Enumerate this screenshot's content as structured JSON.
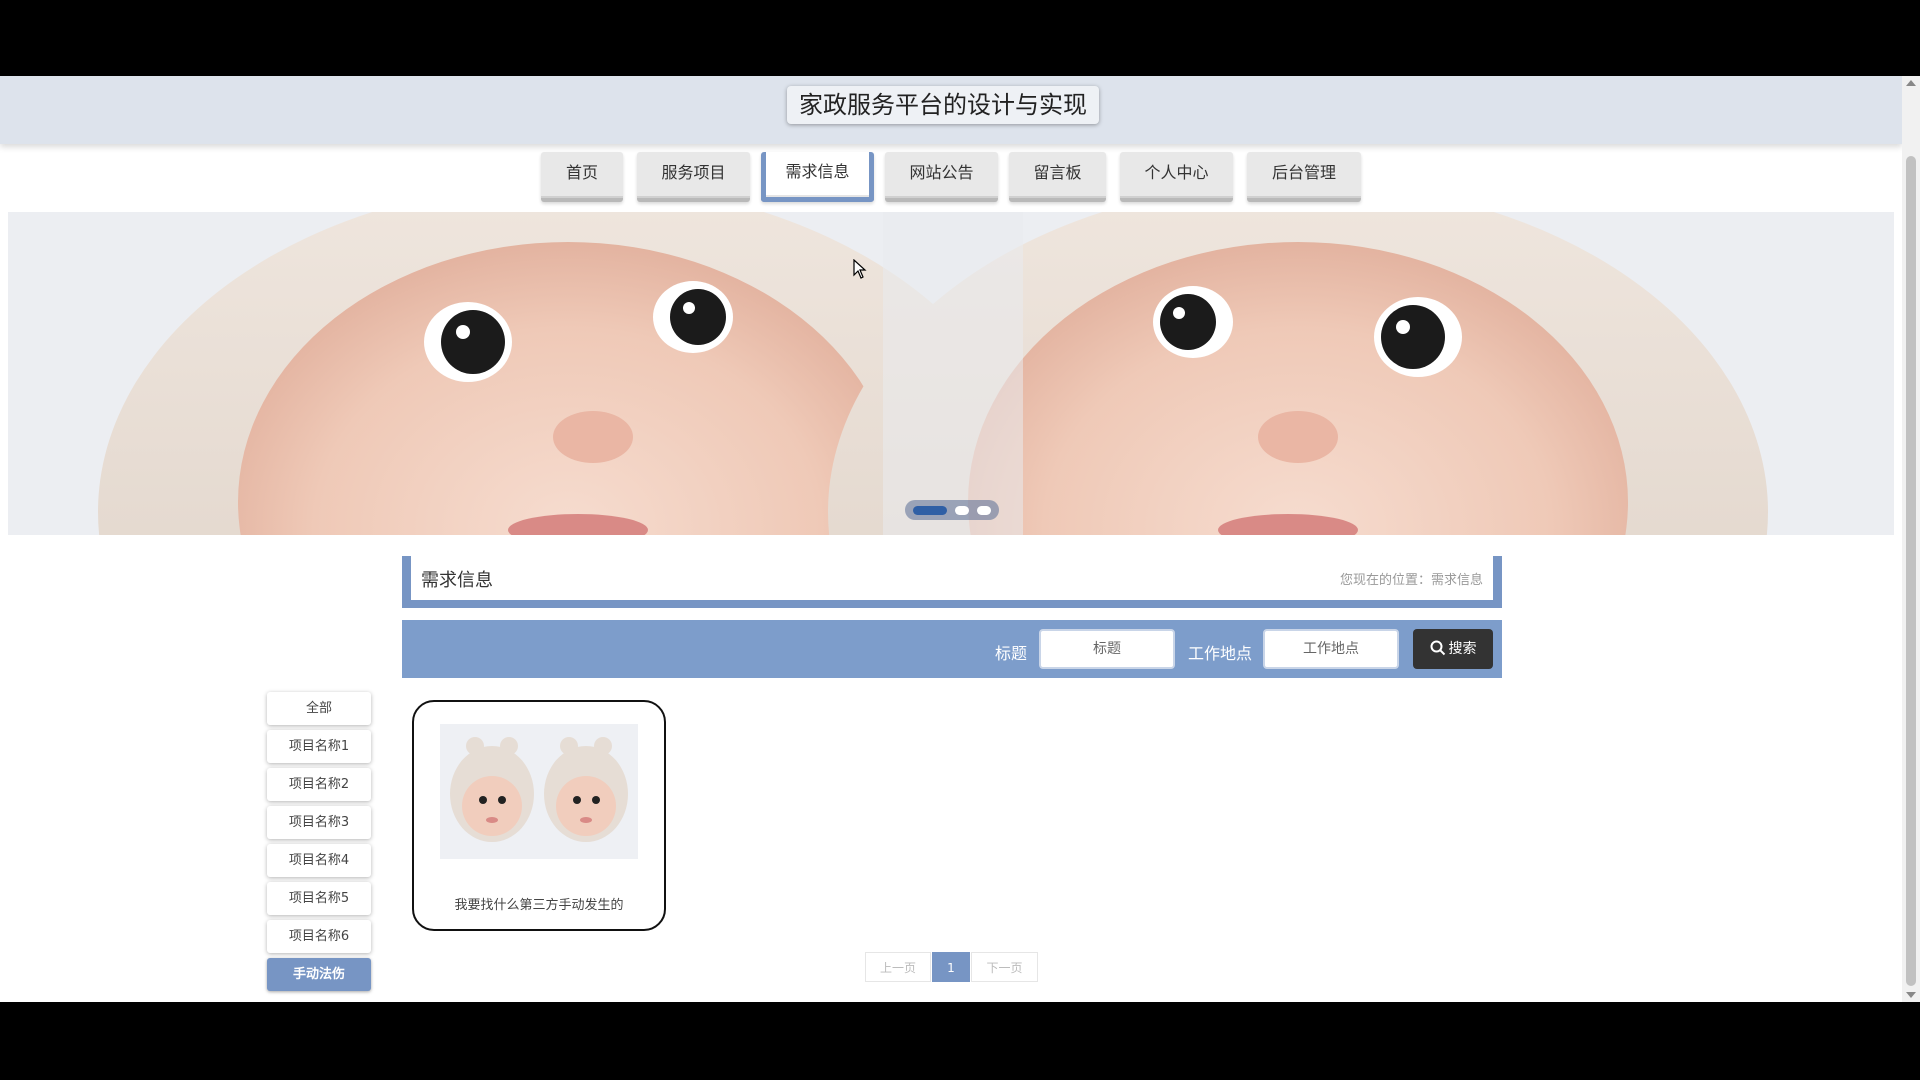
{
  "header": {
    "title": "家政服务平台的设计与实现"
  },
  "nav": {
    "items": [
      {
        "label": "首页"
      },
      {
        "label": "服务项目"
      },
      {
        "label": "需求信息"
      },
      {
        "label": "网站公告"
      },
      {
        "label": "留言板"
      },
      {
        "label": "个人中心"
      },
      {
        "label": "后台管理"
      }
    ],
    "active_index": 2
  },
  "banner": {
    "slide_count": 3,
    "active_slide": 1
  },
  "section": {
    "title": "需求信息",
    "breadcrumb": "您现在的位置：需求信息"
  },
  "search": {
    "title_label": "标题",
    "title_placeholder": "标题",
    "location_label": "工作地点",
    "location_placeholder": "工作地点",
    "button_label": "搜索"
  },
  "categories": {
    "items": [
      {
        "label": "全部"
      },
      {
        "label": "项目名称1"
      },
      {
        "label": "项目名称2"
      },
      {
        "label": "项目名称3"
      },
      {
        "label": "项目名称4"
      },
      {
        "label": "项目名称5"
      },
      {
        "label": "项目名称6"
      },
      {
        "label": "手动法伤"
      }
    ],
    "active_index": 7
  },
  "listing": {
    "cards": [
      {
        "title": "我要找什么第三方手动发生的"
      }
    ]
  },
  "pagination": {
    "prev_label": "上一页",
    "current_page": "1",
    "next_label": "下一页"
  },
  "colors": {
    "accent": "#7795c4",
    "search_bar": "#7d9dcb",
    "header_bg": "#dde3ec",
    "button_dark": "#333333"
  },
  "icons": {
    "search": "search-icon",
    "cursor": "mouse-pointer-icon"
  }
}
